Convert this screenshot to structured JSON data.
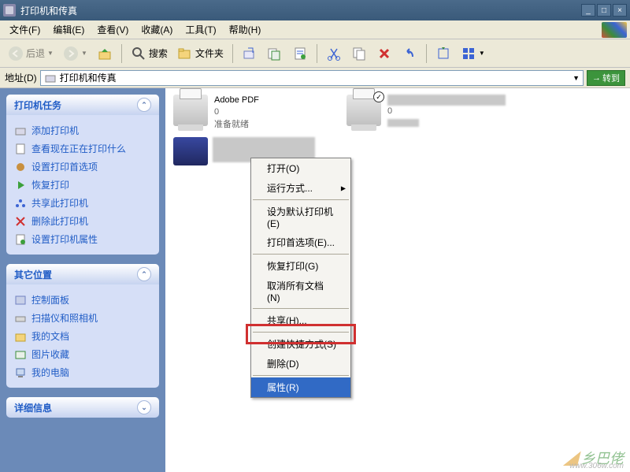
{
  "window": {
    "title": "打印机和传真"
  },
  "menubar": [
    "文件(F)",
    "编辑(E)",
    "查看(V)",
    "收藏(A)",
    "工具(T)",
    "帮助(H)"
  ],
  "toolbar": {
    "back": "后退",
    "search": "搜索",
    "folders": "文件夹"
  },
  "addressbar": {
    "label": "地址(D)",
    "value": "打印机和传真",
    "go": "转到"
  },
  "sidebar": {
    "panel1": {
      "title": "打印机任务",
      "items": [
        "添加打印机",
        "查看现在正在打印什么",
        "设置打印首选项",
        "恢复打印",
        "共享此打印机",
        "删除此打印机",
        "设置打印机属性"
      ]
    },
    "panel2": {
      "title": "其它位置",
      "items": [
        "控制面板",
        "扫描仪和照相机",
        "我的文档",
        "图片收藏",
        "我的电脑"
      ]
    },
    "panel3": {
      "title": "详细信息"
    }
  },
  "content": {
    "printers": [
      {
        "name": "Adobe PDF",
        "count": "0",
        "status": "准备就绪"
      },
      {
        "name": "",
        "count": "0",
        "status": ""
      }
    ]
  },
  "contextmenu": {
    "items": [
      {
        "label": "打开(O)",
        "type": "item"
      },
      {
        "label": "运行方式...",
        "type": "submenu"
      },
      {
        "type": "sep"
      },
      {
        "label": "设为默认打印机(E)",
        "type": "item"
      },
      {
        "label": "打印首选项(E)...",
        "type": "item"
      },
      {
        "type": "sep"
      },
      {
        "label": "恢复打印(G)",
        "type": "item"
      },
      {
        "label": "取消所有文档(N)",
        "type": "item"
      },
      {
        "type": "sep"
      },
      {
        "label": "共享(H)...",
        "type": "item"
      },
      {
        "type": "sep"
      },
      {
        "label": "创建快捷方式(S)",
        "type": "item"
      },
      {
        "label": "删除(D)",
        "type": "item"
      },
      {
        "type": "sep"
      },
      {
        "label": "属性(R)",
        "type": "item",
        "highlighted": true
      }
    ]
  },
  "watermark": {
    "text": "乡巴佬",
    "url": "www.306w.com"
  }
}
